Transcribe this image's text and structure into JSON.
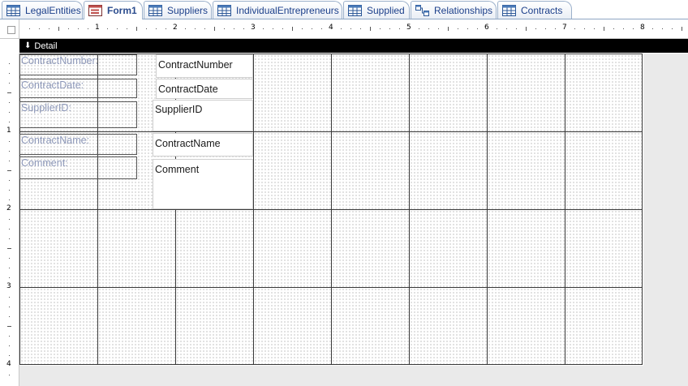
{
  "tabs": [
    {
      "label": "LegalEntities",
      "icon": "table-icon"
    },
    {
      "label": "Form1",
      "icon": "form-icon",
      "active": true
    },
    {
      "label": "Suppliers",
      "icon": "table-icon"
    },
    {
      "label": "IndividualEntrepreneurs",
      "icon": "table-icon"
    },
    {
      "label": "Supplied",
      "icon": "table-icon"
    },
    {
      "label": "Relationships",
      "icon": "relationships-icon"
    },
    {
      "label": "Contracts",
      "icon": "table-icon"
    }
  ],
  "ruler": {
    "horizontal_numbers": [
      "1",
      "2",
      "3",
      "4",
      "5",
      "6",
      "7",
      "8"
    ],
    "vertical_numbers": [
      "1",
      "2",
      "3",
      "4"
    ]
  },
  "section": {
    "label": "Detail"
  },
  "controls": {
    "labels": [
      "ContractNumber:",
      "ContractDate:",
      "SupplierID:",
      "ContractName:",
      "Comment:"
    ],
    "textboxes": [
      "ContractNumber",
      "ContractDate",
      "SupplierID",
      "ContractName",
      "Comment"
    ]
  },
  "colors": {
    "tab_text": "#1b3f8a",
    "label_text": "#8c97b8",
    "section_bar": "#000000"
  }
}
